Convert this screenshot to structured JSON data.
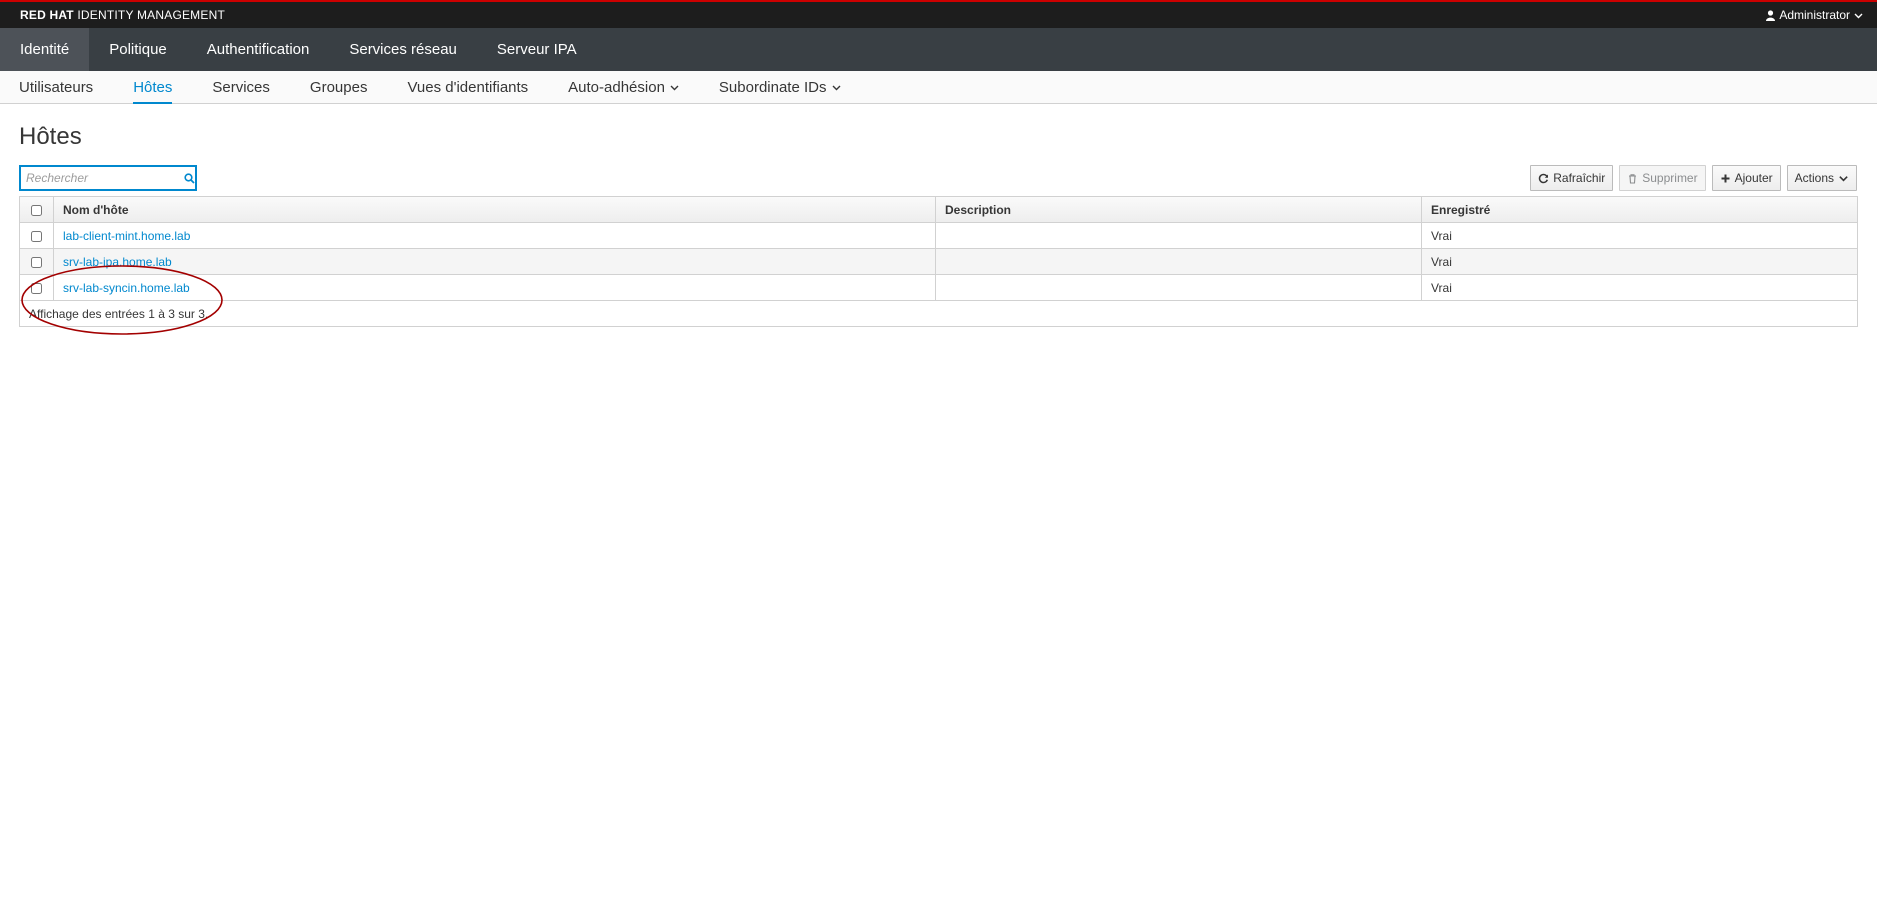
{
  "header": {
    "brand_bold": "RED HAT",
    "brand_rest": "IDENTITY MANAGEMENT",
    "user": "Administrator"
  },
  "main_nav": [
    {
      "label": "Identité",
      "active": true
    },
    {
      "label": "Politique"
    },
    {
      "label": "Authentification"
    },
    {
      "label": "Services réseau"
    },
    {
      "label": "Serveur IPA"
    }
  ],
  "sub_nav": [
    {
      "label": "Utilisateurs"
    },
    {
      "label": "Hôtes",
      "active": true
    },
    {
      "label": "Services"
    },
    {
      "label": "Groupes"
    },
    {
      "label": "Vues d'identifiants"
    },
    {
      "label": "Auto-adhésion",
      "dropdown": true
    },
    {
      "label": "Subordinate IDs",
      "dropdown": true
    }
  ],
  "page": {
    "title": "Hôtes",
    "search_placeholder": "Rechercher"
  },
  "toolbar": {
    "refresh": "Rafraîchir",
    "delete": "Supprimer",
    "add": "Ajouter",
    "actions": "Actions"
  },
  "table": {
    "columns": [
      "Nom d'hôte",
      "Description",
      "Enregistré"
    ],
    "rows": [
      {
        "hostname": "lab-client-mint.home.lab",
        "description": "",
        "enrolled": "Vrai"
      },
      {
        "hostname": "srv-lab-ipa.home.lab",
        "description": "",
        "enrolled": "Vrai"
      },
      {
        "hostname": "srv-lab-syncin.home.lab",
        "description": "",
        "enrolled": "Vrai"
      }
    ],
    "footer": "Affichage des entrées 1 à 3 sur 3."
  },
  "colors": {
    "accent": "#0088ce",
    "annotation": "#a30000"
  }
}
